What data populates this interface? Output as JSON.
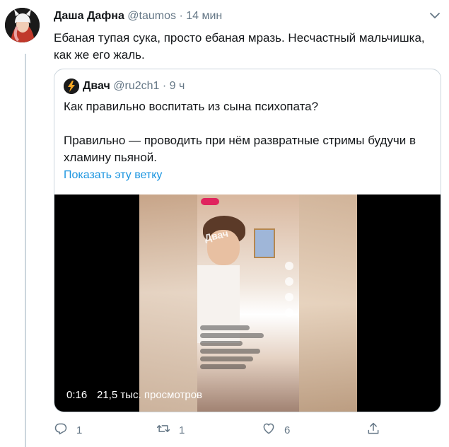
{
  "tweet": {
    "author_name": "Даша Дафна",
    "author_handle": "@taumos",
    "separator": "·",
    "time": "14 мин",
    "text": "Ебаная тупая сука, просто ебаная мразь. Несчастный мальчишка, как же его жаль."
  },
  "quoted_tweet": {
    "author_name": "Двач",
    "author_handle": "@ru2ch1",
    "separator": "·",
    "time": "9 ч",
    "text_line1": "Как правильно воспитать из сына психопата?",
    "text_line2": "Правильно — проводить при нём развратные стримы будучи в хламину пьяной.",
    "show_thread_link": "Показать эту ветку",
    "video": {
      "elapsed": "0:16",
      "views": "21,5 тыс. просмотров",
      "watermark": "Двач"
    }
  },
  "actions": {
    "reply_count": "1",
    "retweet_count": "1",
    "like_count": "6"
  },
  "icons": [
    "chevron-down-icon",
    "reply-icon",
    "retweet-icon",
    "like-icon",
    "share-icon"
  ],
  "colors": {
    "link": "#1b95e0",
    "secondary_text": "#657786",
    "border": "#ccd6dd"
  }
}
